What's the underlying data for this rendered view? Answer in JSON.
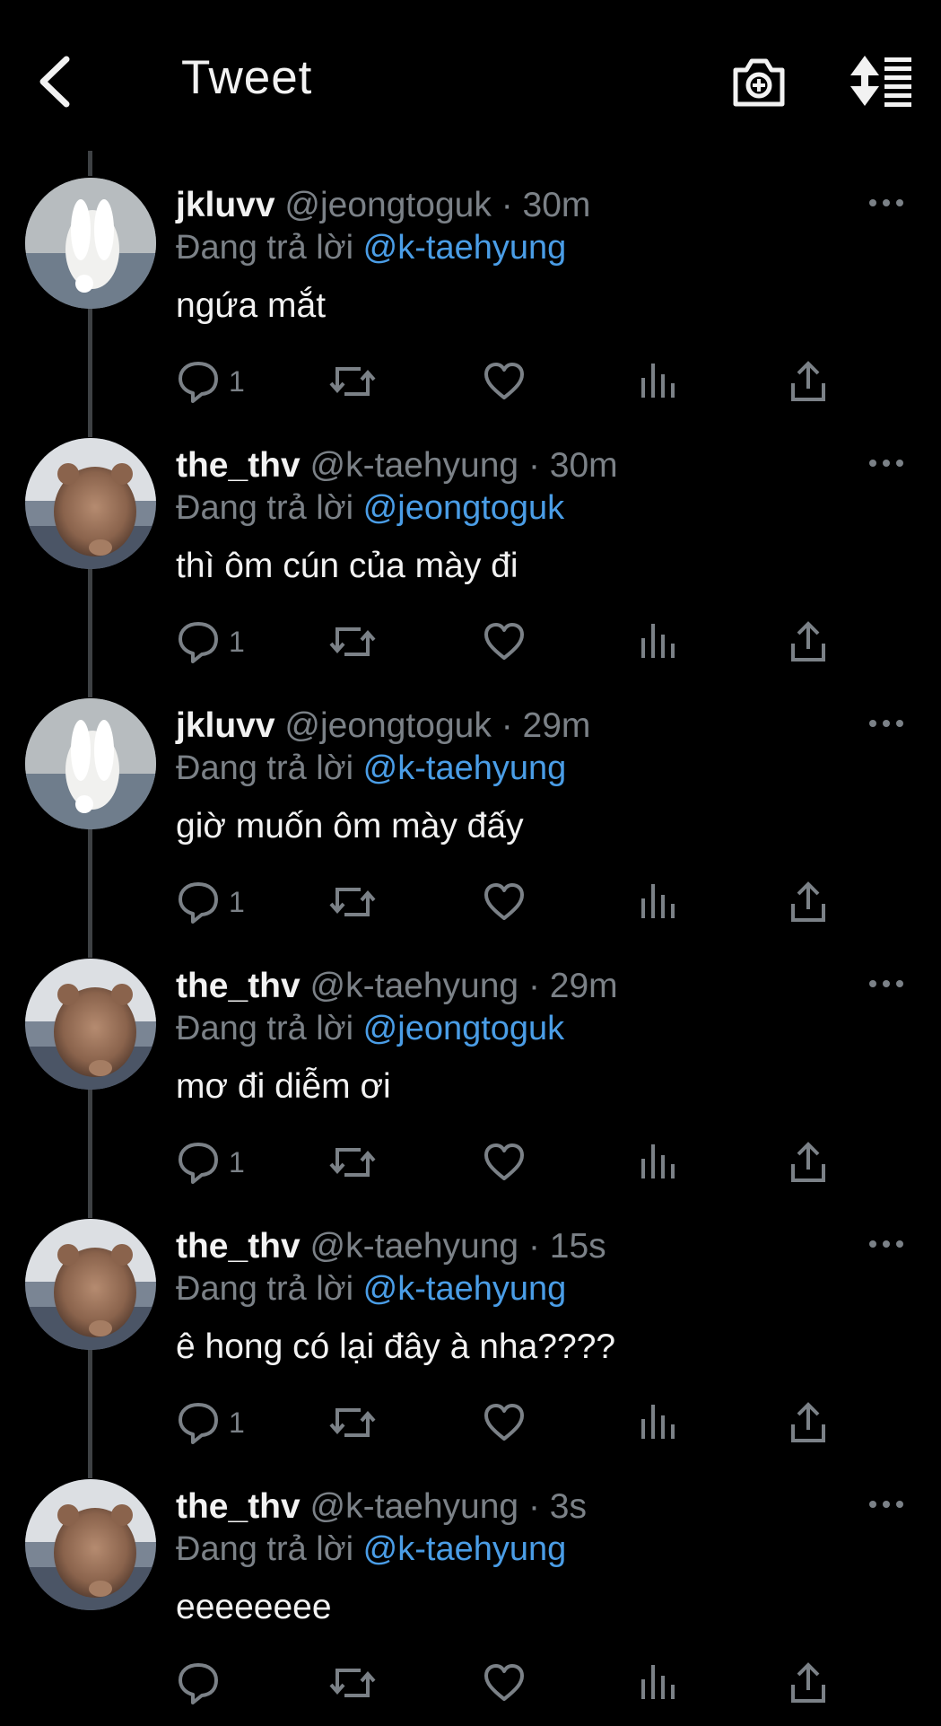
{
  "header": {
    "title": "Tweet"
  },
  "icons": {
    "back": "chevron-left-icon",
    "camera": "camera-plus-icon",
    "sort": "sort-list-icon",
    "more": "more-horizontal-icon",
    "reply": "reply-bubble-icon",
    "retweet": "retweet-icon",
    "like": "heart-icon",
    "analytics": "analytics-bars-icon",
    "share": "share-upload-icon"
  },
  "colors": {
    "background": "#000000",
    "text": "#f2f2f2",
    "muted": "#7b8187",
    "mention": "#4a9de6"
  },
  "tweets": [
    {
      "name": "jkluvv",
      "handle": "@jeongtoguk",
      "sep": "·",
      "time": "30m",
      "reply_prefix": "Đang trả lời",
      "reply_to": "@k-taehyung",
      "text": "ngứa mắt",
      "reply_count": "1",
      "avatar": "rabbit"
    },
    {
      "name": "the_thv",
      "handle": "@k-taehyung",
      "sep": "·",
      "time": "30m",
      "reply_prefix": "Đang trả lời",
      "reply_to": "@jeongtoguk",
      "text": "thì ôm cún của mày đi",
      "reply_count": "1",
      "avatar": "bear"
    },
    {
      "name": "jkluvv",
      "handle": "@jeongtoguk",
      "sep": "·",
      "time": "29m",
      "reply_prefix": "Đang trả lời",
      "reply_to": "@k-taehyung",
      "text": "giờ muốn ôm mày đấy",
      "reply_count": "1",
      "avatar": "rabbit"
    },
    {
      "name": "the_thv",
      "handle": "@k-taehyung",
      "sep": "·",
      "time": "29m",
      "reply_prefix": "Đang trả lời",
      "reply_to": "@jeongtoguk",
      "text": "mơ đi diễm ơi",
      "reply_count": "1",
      "avatar": "bear"
    },
    {
      "name": "the_thv",
      "handle": "@k-taehyung",
      "sep": "·",
      "time": "15s",
      "reply_prefix": "Đang trả lời",
      "reply_to": "@k-taehyung",
      "text": "ê hong có lại đây à nha????",
      "reply_count": "1",
      "avatar": "bear"
    },
    {
      "name": "the_thv",
      "handle": "@k-taehyung",
      "sep": "·",
      "time": "3s",
      "reply_prefix": "Đang trả lời",
      "reply_to": "@k-taehyung",
      "text": "eeeeeeee",
      "reply_count": "",
      "avatar": "bear"
    }
  ]
}
